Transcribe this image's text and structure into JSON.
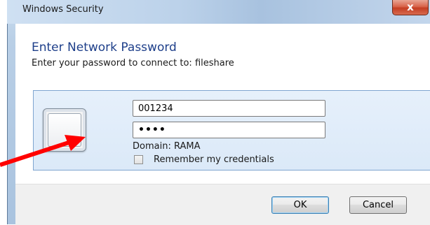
{
  "window": {
    "title": "Windows Security",
    "close_glyph": "x"
  },
  "dialog": {
    "heading": "Enter Network Password",
    "subheading": "Enter your password to connect to: fileshare"
  },
  "credentials": {
    "username_value": "001234",
    "password_value": "••••",
    "domain_label": "Domain: RAMA",
    "remember_label": "Remember my credentials",
    "remember_checked": false,
    "user_tile_icon": "user-tile-icon"
  },
  "buttons": {
    "ok_label": "OK",
    "cancel_label": "Cancel"
  },
  "annotation": {
    "arrow_color": "#ff0000",
    "arrow_icon": "red-pointer-arrow"
  }
}
